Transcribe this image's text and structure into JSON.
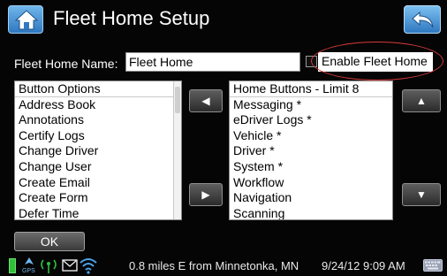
{
  "header": {
    "title": "Fleet Home Setup",
    "home_icon": "home-icon",
    "back_icon": "back-arrow-icon"
  },
  "form": {
    "name_label": "Fleet Home Name:",
    "name_value": "Fleet Home",
    "enable_label": "Enable Fleet Home",
    "enable_checked": false
  },
  "left_list": {
    "header": "Button Options",
    "items": [
      "Address Book",
      "Annotations",
      "Certify Logs",
      "Change Driver",
      "Change User",
      "Create Email",
      "Create Form",
      "Defer Time"
    ]
  },
  "right_list": {
    "header": "Home Buttons - Limit 8",
    "items": [
      "Messaging *",
      "eDriver Logs *",
      "Vehicle *",
      "Driver *",
      "System *",
      "Workflow",
      "Navigation",
      "Scanning"
    ]
  },
  "buttons": {
    "move_left": "◀",
    "move_right": "▶",
    "move_up": "▲",
    "move_down": "▼",
    "ok": "OK"
  },
  "status": {
    "location": "0.8 miles E from Minnetonka, MN",
    "datetime": "9/24/12 9:09 AM",
    "gps_label": "GPS"
  },
  "colors": {
    "highlight_ring": "#d63a3a",
    "accent_blue": "#2f78c0",
    "battery_green": "#2fbf3a"
  }
}
